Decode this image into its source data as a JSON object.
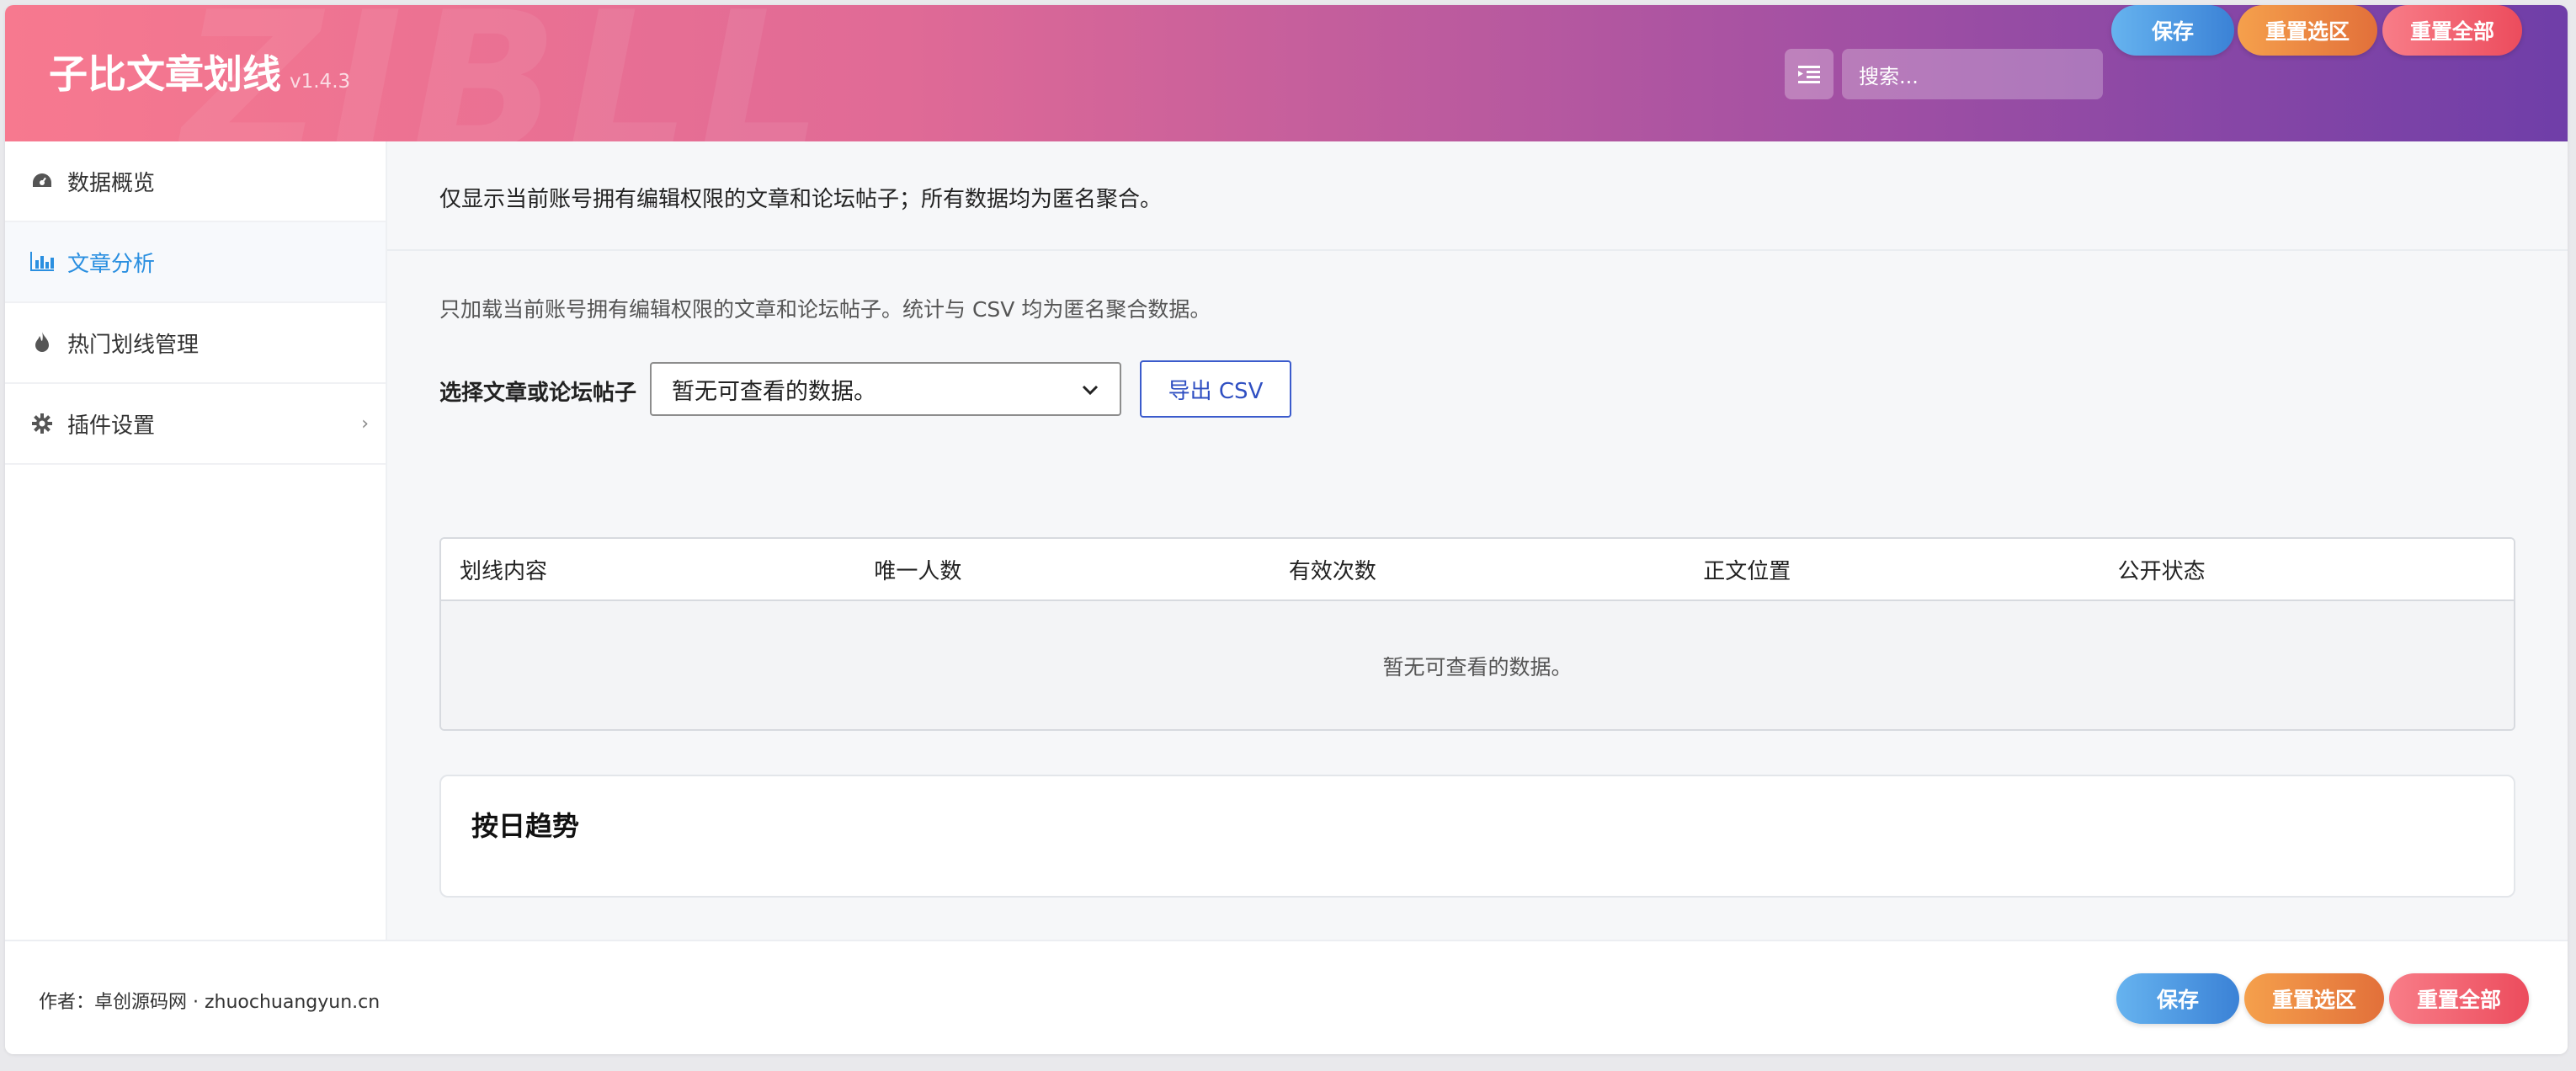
{
  "header": {
    "title": "子比文章划线",
    "version": "v1.4.3",
    "watermark": "ZIBLL",
    "search_placeholder": "搜索...",
    "toggle_icon": "list-indent-icon",
    "save_label": "保存",
    "reset_section_label": "重置选区",
    "reset_all_label": "重置全部"
  },
  "sidebar": {
    "items": [
      {
        "label": "数据概览",
        "icon": "dashboard-icon"
      },
      {
        "label": "文章分析",
        "icon": "bar-chart-icon",
        "active": true
      },
      {
        "label": "热门划线管理",
        "icon": "fire-icon"
      },
      {
        "label": "插件设置",
        "icon": "gear-icon",
        "chevron": "›"
      }
    ]
  },
  "main": {
    "notice": "仅显示当前账号拥有编辑权限的文章和论坛帖子；所有数据均为匿名聚合。",
    "description": "只加载当前账号拥有编辑权限的文章和论坛帖子。统计与 CSV 均为匿名聚合数据。",
    "select_label": "选择文章或论坛帖子",
    "select_value": "暂无可查看的数据。",
    "export_label": "导出 CSV",
    "table": {
      "columns": [
        "划线内容",
        "唯一人数",
        "有效次数",
        "正文位置",
        "公开状态"
      ],
      "empty_text": "暂无可查看的数据。"
    },
    "trend_title": "按日趋势"
  },
  "footer": {
    "credit": "作者：卓创源码网 · zhuochuangyun.cn",
    "save_label": "保存",
    "reset_section_label": "重置选区",
    "reset_all_label": "重置全部"
  },
  "colors": {
    "accent": "#2a8fe0",
    "header_gradient_start": "#f7798f",
    "header_gradient_end": "#6f3ea8"
  }
}
